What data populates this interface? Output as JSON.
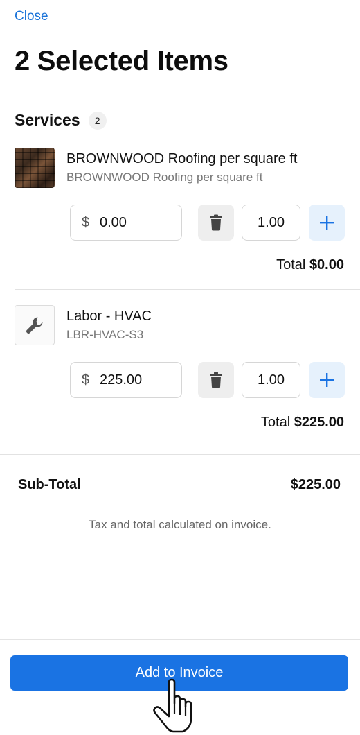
{
  "header": {
    "close_label": "Close",
    "title": "2 Selected Items"
  },
  "section": {
    "title": "Services",
    "count": "2"
  },
  "items": [
    {
      "name": "BROWNWOOD Roofing per square ft",
      "subtitle": "BROWNWOOD Roofing per square ft",
      "thumbnail": "roof-shingles-image",
      "currency_symbol": "$",
      "price": "0.00",
      "quantity": "1.00",
      "total_label": "Total",
      "total": "$0.00"
    },
    {
      "name": "Labor - HVAC",
      "subtitle": "LBR-HVAC-S3",
      "thumbnail": "wrench-icon",
      "currency_symbol": "$",
      "price": "225.00",
      "quantity": "1.00",
      "total_label": "Total",
      "total": "$225.00"
    }
  ],
  "summary": {
    "subtotal_label": "Sub-Total",
    "subtotal_value": "$225.00",
    "tax_note": "Tax and total calculated on invoice."
  },
  "footer": {
    "button_label": "Add to Invoice"
  },
  "colors": {
    "accent": "#1a73e3",
    "link": "#1a73d9",
    "plus_bg": "#e6f1fc"
  }
}
